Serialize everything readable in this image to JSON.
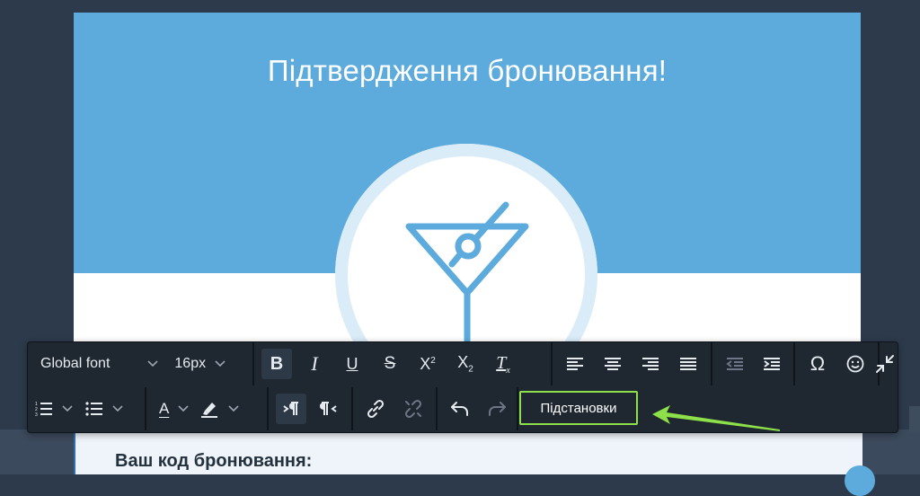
{
  "email": {
    "title": "Підтвердження бронювання!",
    "code_heading": "Ваш код бронювання:",
    "hero_color": "#5dabdd",
    "hero_icon": "cocktail-glass-icon"
  },
  "toolbar": {
    "font_family": "Global font",
    "font_size": "16px",
    "bold_label": "B",
    "italic_label": "I",
    "underline_label": "U",
    "strike_label": "S",
    "superscript_label": "X",
    "superscript_mark": "2",
    "subscript_label": "X",
    "subscript_mark": "2",
    "clear_format_label": "T",
    "clear_format_mark": "x",
    "special_char_label": "Ω",
    "font_color_label": "A",
    "substitutions_label": "Підстановки",
    "highlight_color": "#8ee04a",
    "icons": [
      "bold-icon",
      "italic-icon",
      "underline-icon",
      "strikethrough-icon",
      "superscript-icon",
      "subscript-icon",
      "clear-format-icon",
      "align-left-icon",
      "align-center-icon",
      "align-right-icon",
      "align-justify-icon",
      "outdent-icon",
      "indent-icon",
      "special-char-icon",
      "emoji-icon",
      "collapse-icon",
      "ordered-list-icon",
      "unordered-list-icon",
      "font-color-icon",
      "highlight-icon",
      "ltr-icon",
      "rtl-icon",
      "link-icon",
      "unlink-icon",
      "undo-icon",
      "redo-icon"
    ]
  }
}
